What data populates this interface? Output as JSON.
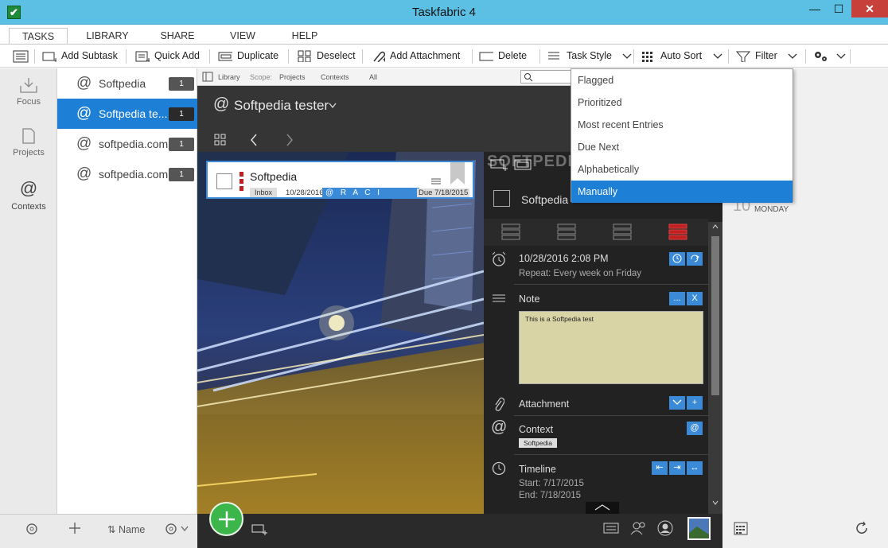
{
  "window": {
    "title": "Taskfabric 4",
    "app_icon": "✔",
    "min": "—",
    "max": "☐",
    "close": "✕"
  },
  "tabs": [
    "TASKS",
    "LIBRARY",
    "SHARE",
    "VIEW",
    "HELP"
  ],
  "toolbar": {
    "add_subtask": "Add Subtask",
    "quick_add": "Quick Add",
    "duplicate": "Duplicate",
    "deselect": "Deselect",
    "add_attachment": "Add Attachment",
    "delete": "Delete",
    "task_style": "Task Style",
    "auto_sort": "Auto Sort",
    "filter": "Filter"
  },
  "leftnav": [
    {
      "label": "Focus",
      "icon": "inbox-icon"
    },
    {
      "label": "Projects",
      "icon": "document-icon"
    },
    {
      "label": "Contexts",
      "icon": "at-icon"
    }
  ],
  "contexts": [
    {
      "label": "Softpedia",
      "count": "1"
    },
    {
      "label": "Softpedia te...",
      "count": "1"
    },
    {
      "label": "softpedia.com",
      "count": "1"
    },
    {
      "label": "softpedia.com",
      "count": "1"
    }
  ],
  "scopebar": {
    "library": "Library",
    "scope": "Scope:",
    "projects": "Projects",
    "contexts": "Contexts",
    "all": "All"
  },
  "main": {
    "header": "Softpedia tester"
  },
  "task": {
    "title": "Softpedia",
    "tag": "Inbox",
    "date": "10/28/2016",
    "raci": "@ R A C I",
    "due": "Due 7/18/2015"
  },
  "detail": {
    "title": "Softpedia",
    "reminder": "10/28/2016 2:08 PM",
    "repeat": "Repeat: Every week on Friday",
    "note_label": "Note",
    "note_text": "This is a Softpedia test",
    "attachment_label": "Attachment",
    "context_label": "Context",
    "context_tag": "Softpedia",
    "timeline_label": "Timeline",
    "start": "Start: 7/17/2015",
    "end": "End: 7/18/2015"
  },
  "dropdown": [
    "Flagged",
    "Prioritized",
    "Most recent Entries",
    "Due Next",
    "Alphabetically",
    "Manually"
  ],
  "calendar": {
    "day": "10",
    "weekday": "MONDAY"
  },
  "watermark": "SOFTPEDIA",
  "bottom": {
    "sort_label": "Name"
  },
  "colors": {
    "accent": "#1e7fd6",
    "titlebar": "#5bc0e3",
    "close": "#c7403a",
    "add_button": "#3cb54a",
    "priority": "#c02020"
  }
}
